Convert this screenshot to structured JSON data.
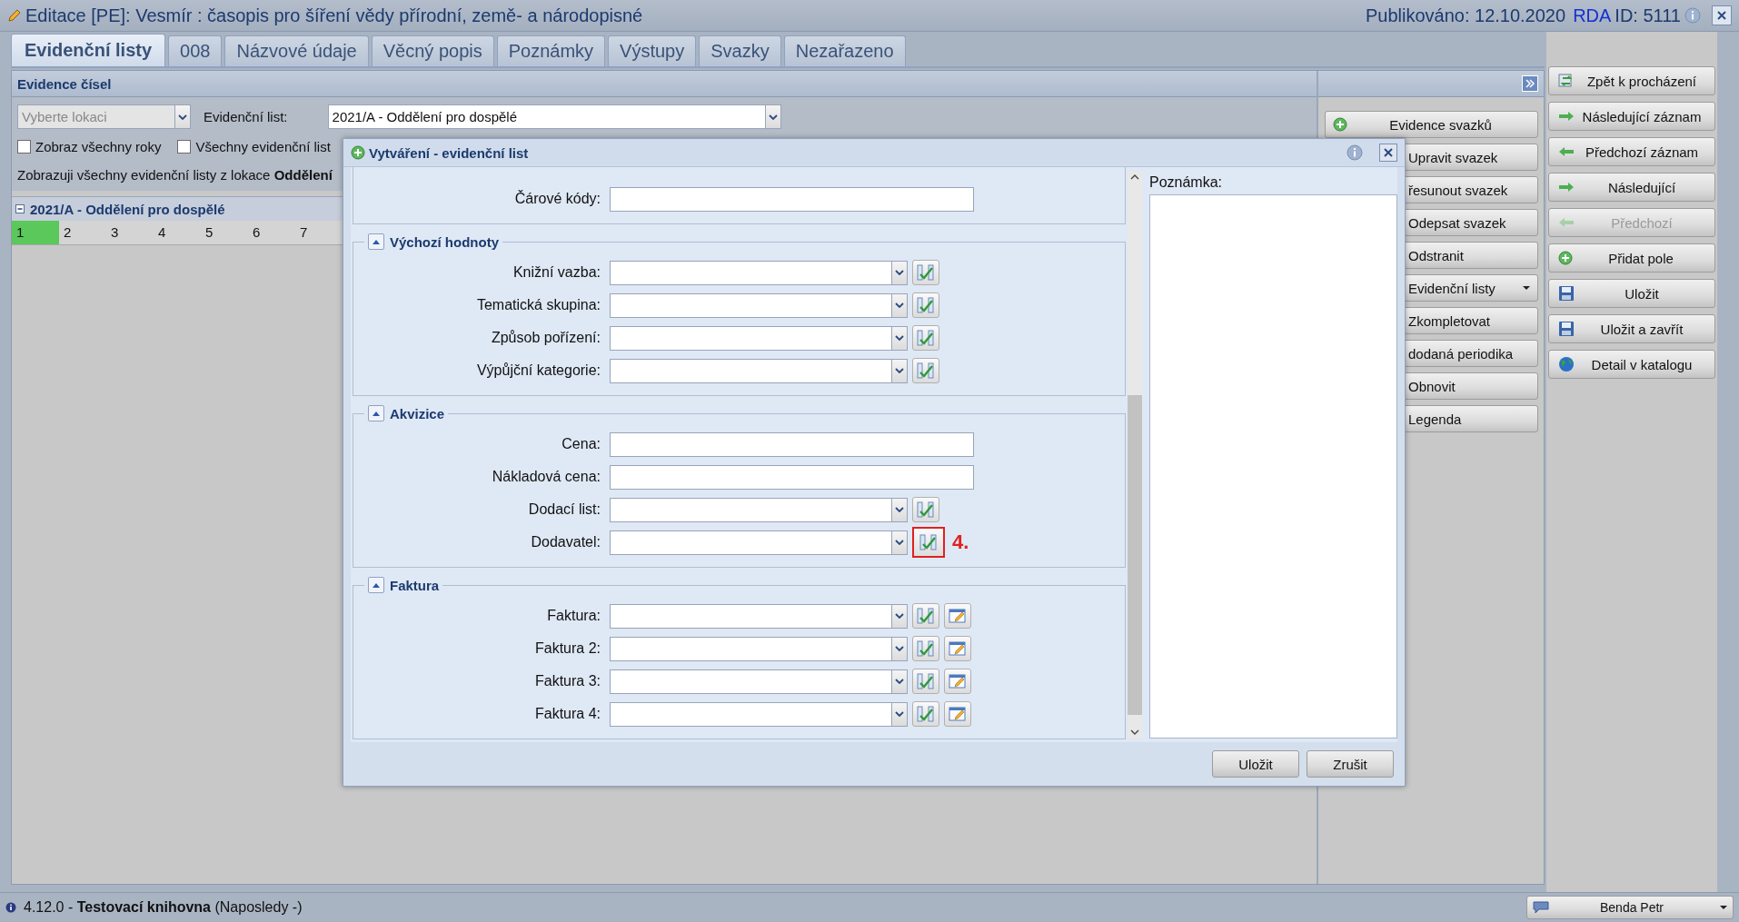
{
  "window": {
    "title": "Editace [PE]: Vesmír : časopis pro šíření vědy přírodní, země- a národopisné",
    "published": "Publikováno: 12.10.2020",
    "rda": "RDA",
    "id": "ID: 5111"
  },
  "tabs": [
    {
      "label": "Evidenční listy",
      "selected": true
    },
    {
      "label": "008",
      "selected": false
    },
    {
      "label": "Názvové údaje",
      "selected": false
    },
    {
      "label": "Věcný popis",
      "selected": false
    },
    {
      "label": "Poznámky",
      "selected": false
    },
    {
      "label": "Výstupy",
      "selected": false
    },
    {
      "label": "Svazky",
      "selected": false
    },
    {
      "label": "Nezařazeno",
      "selected": false
    }
  ],
  "panel": {
    "title": "Evidence čísel",
    "location": {
      "placeholder": "Vyberte lokaci"
    },
    "list_label": "Evidenční list:",
    "list_value": "2021/A - Oddělení pro dospělé",
    "checkboxes": [
      {
        "label": "Zobraz všechny roky",
        "checked": false
      },
      {
        "label": "Všechny evidenční list",
        "checked": false
      }
    ],
    "info": "Zobrazuji všechny evidenční listy z lokace **Oddělení**",
    "group": {
      "title": "2021/A - Oddělení pro dospělé",
      "expanded": true,
      "issues": [
        {
          "label": "1",
          "selected": true
        },
        {
          "label": "2",
          "selected": false
        },
        {
          "label": "3",
          "selected": false
        },
        {
          "label": "4",
          "selected": false
        },
        {
          "label": "5",
          "selected": false
        },
        {
          "label": "6",
          "selected": false
        },
        {
          "label": "7",
          "selected": false
        }
      ]
    }
  },
  "volume_buttons": [
    {
      "label": "Evidence svazků",
      "kind": "add"
    },
    {
      "label": "Upravit svazek",
      "kind": "plain"
    },
    {
      "label": "řesunout svazek",
      "kind": "plain"
    },
    {
      "label": "Odepsat svazek",
      "kind": "plain"
    },
    {
      "label": "Odstranit",
      "kind": "plain"
    },
    {
      "label": "Evidenční listy",
      "kind": "menu"
    },
    {
      "label": "Zkompletovat",
      "kind": "plain"
    },
    {
      "label": "dodaná periodika",
      "kind": "plain"
    },
    {
      "label": "Obnovit",
      "kind": "plain"
    },
    {
      "label": "Legenda",
      "kind": "plain"
    }
  ],
  "side_buttons": [
    {
      "label": "Zpět k procházení",
      "kind": "back",
      "disabled": false
    },
    {
      "label": "Následující záznam",
      "kind": "next",
      "disabled": false
    },
    {
      "label": "Předchozí záznam",
      "kind": "prev",
      "disabled": false
    },
    {
      "label": "Následující",
      "kind": "next",
      "disabled": false
    },
    {
      "label": "Předchozí",
      "kind": "prev",
      "disabled": true
    },
    {
      "label": "Přidat pole",
      "kind": "add",
      "disabled": false
    },
    {
      "label": "Uložit",
      "kind": "save",
      "disabled": false
    },
    {
      "label": "Uložit a zavřít",
      "kind": "save",
      "disabled": false
    },
    {
      "label": "Detail v katalogu",
      "kind": "globe",
      "disabled": false
    }
  ],
  "dialog": {
    "title": "Vytváření - evidenční list",
    "sections": [
      {
        "rows": [
          {
            "label": "Čárové kódy:",
            "kind": "text"
          }
        ]
      },
      {
        "legend": "Výchozí hodnoty",
        "expanded": true,
        "rows": [
          {
            "label": "Knižní vazba:",
            "kind": "combo",
            "actions": [
              {
                "kind": "pick"
              }
            ]
          },
          {
            "label": "Tematická skupina:",
            "kind": "combo",
            "actions": [
              {
                "kind": "pick"
              }
            ]
          },
          {
            "label": "Způsob pořízení:",
            "kind": "combo",
            "actions": [
              {
                "kind": "pick"
              }
            ]
          },
          {
            "label": "Výpůjční kategorie:",
            "kind": "combo",
            "actions": [
              {
                "kind": "pick"
              }
            ]
          }
        ]
      },
      {
        "legend": "Akvizice",
        "expanded": true,
        "rows": [
          {
            "label": "Cena:",
            "kind": "text"
          },
          {
            "label": "Nákladová cena:",
            "kind": "text"
          },
          {
            "label": "Dodací list:",
            "kind": "combo",
            "actions": [
              {
                "kind": "pick"
              }
            ]
          },
          {
            "label": "Dodavatel:",
            "kind": "combo",
            "actions": [
              {
                "kind": "pick",
                "highlighted": true
              }
            ],
            "annotation": "4."
          }
        ]
      },
      {
        "legend": "Faktura",
        "expanded": true,
        "rows": [
          {
            "label": "Faktura:",
            "kind": "combo",
            "actions": [
              {
                "kind": "pick"
              },
              {
                "kind": "edit"
              }
            ]
          },
          {
            "label": "Faktura 2:",
            "kind": "combo",
            "actions": [
              {
                "kind": "pick"
              },
              {
                "kind": "edit"
              }
            ]
          },
          {
            "label": "Faktura 3:",
            "kind": "combo",
            "actions": [
              {
                "kind": "pick"
              },
              {
                "kind": "edit"
              }
            ]
          },
          {
            "label": "Faktura 4:",
            "kind": "combo",
            "actions": [
              {
                "kind": "pick"
              },
              {
                "kind": "edit"
              }
            ]
          }
        ]
      }
    ],
    "note_label": "Poznámka:",
    "buttons": [
      "Uložit",
      "Zrušit"
    ]
  },
  "status": {
    "text": "4.12.0 - **Testovací knihovna** (Naposledy -)",
    "user": "Benda Petr"
  }
}
